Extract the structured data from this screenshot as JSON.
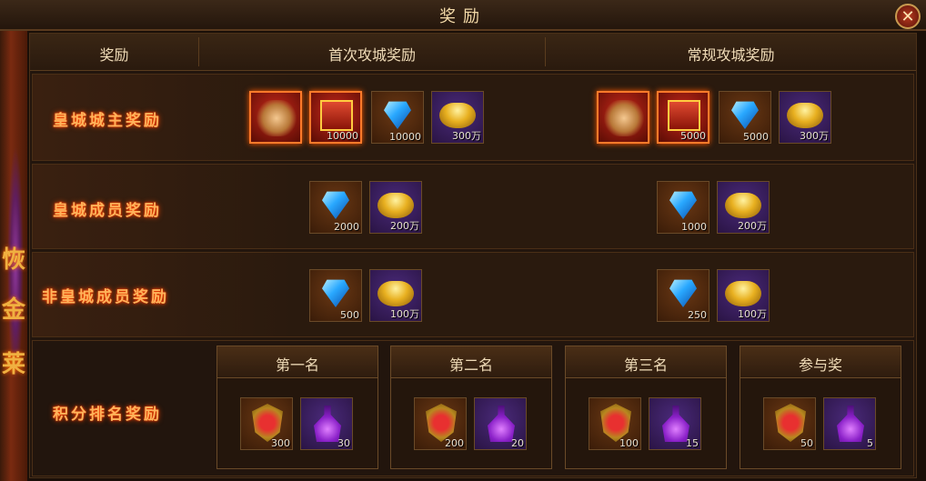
{
  "window": {
    "title": "奖励",
    "close_label": "✕"
  },
  "table": {
    "headers": [
      "奖励",
      "首次攻城奖励",
      "常规攻城奖励"
    ],
    "rows": [
      {
        "label": "皇城城主奖励",
        "first": [
          {
            "icon": "dragon-mount-icon",
            "count": ""
          },
          {
            "icon": "red-chest-icon",
            "count": "10000"
          },
          {
            "icon": "diamond-icon",
            "count": "10000"
          },
          {
            "icon": "gold-ingot-icon",
            "count": "300万"
          }
        ],
        "regular": [
          {
            "icon": "dragon-mount-icon",
            "count": ""
          },
          {
            "icon": "red-chest-icon",
            "count": "5000"
          },
          {
            "icon": "diamond-icon",
            "count": "5000"
          },
          {
            "icon": "gold-ingot-icon",
            "count": "300万"
          }
        ]
      },
      {
        "label": "皇城成员奖励",
        "first": [
          {
            "icon": "diamond-icon",
            "count": "2000"
          },
          {
            "icon": "gold-ingot-icon",
            "count": "200万"
          }
        ],
        "regular": [
          {
            "icon": "diamond-icon",
            "count": "1000"
          },
          {
            "icon": "gold-ingot-icon",
            "count": "200万"
          }
        ]
      },
      {
        "label": "非皇城成员奖励",
        "first": [
          {
            "icon": "diamond-icon",
            "count": "500"
          },
          {
            "icon": "gold-ingot-icon",
            "count": "100万"
          }
        ],
        "regular": [
          {
            "icon": "diamond-icon",
            "count": "250"
          },
          {
            "icon": "gold-ingot-icon",
            "count": "100万"
          }
        ]
      }
    ],
    "ranking": {
      "label": "积分排名奖励",
      "tiers": [
        {
          "name": "第一名",
          "items": [
            {
              "icon": "medal-shield-icon",
              "count": "300"
            },
            {
              "icon": "purple-potion-icon",
              "count": "30"
            }
          ]
        },
        {
          "name": "第二名",
          "items": [
            {
              "icon": "medal-shield-icon",
              "count": "200"
            },
            {
              "icon": "purple-potion-icon",
              "count": "20"
            }
          ]
        },
        {
          "name": "第三名",
          "items": [
            {
              "icon": "medal-shield-icon",
              "count": "100"
            },
            {
              "icon": "purple-potion-icon",
              "count": "15"
            }
          ]
        },
        {
          "name": "参与奖",
          "items": [
            {
              "icon": "medal-shield-icon",
              "count": "50"
            },
            {
              "icon": "purple-potion-icon",
              "count": "5"
            }
          ]
        }
      ]
    }
  }
}
